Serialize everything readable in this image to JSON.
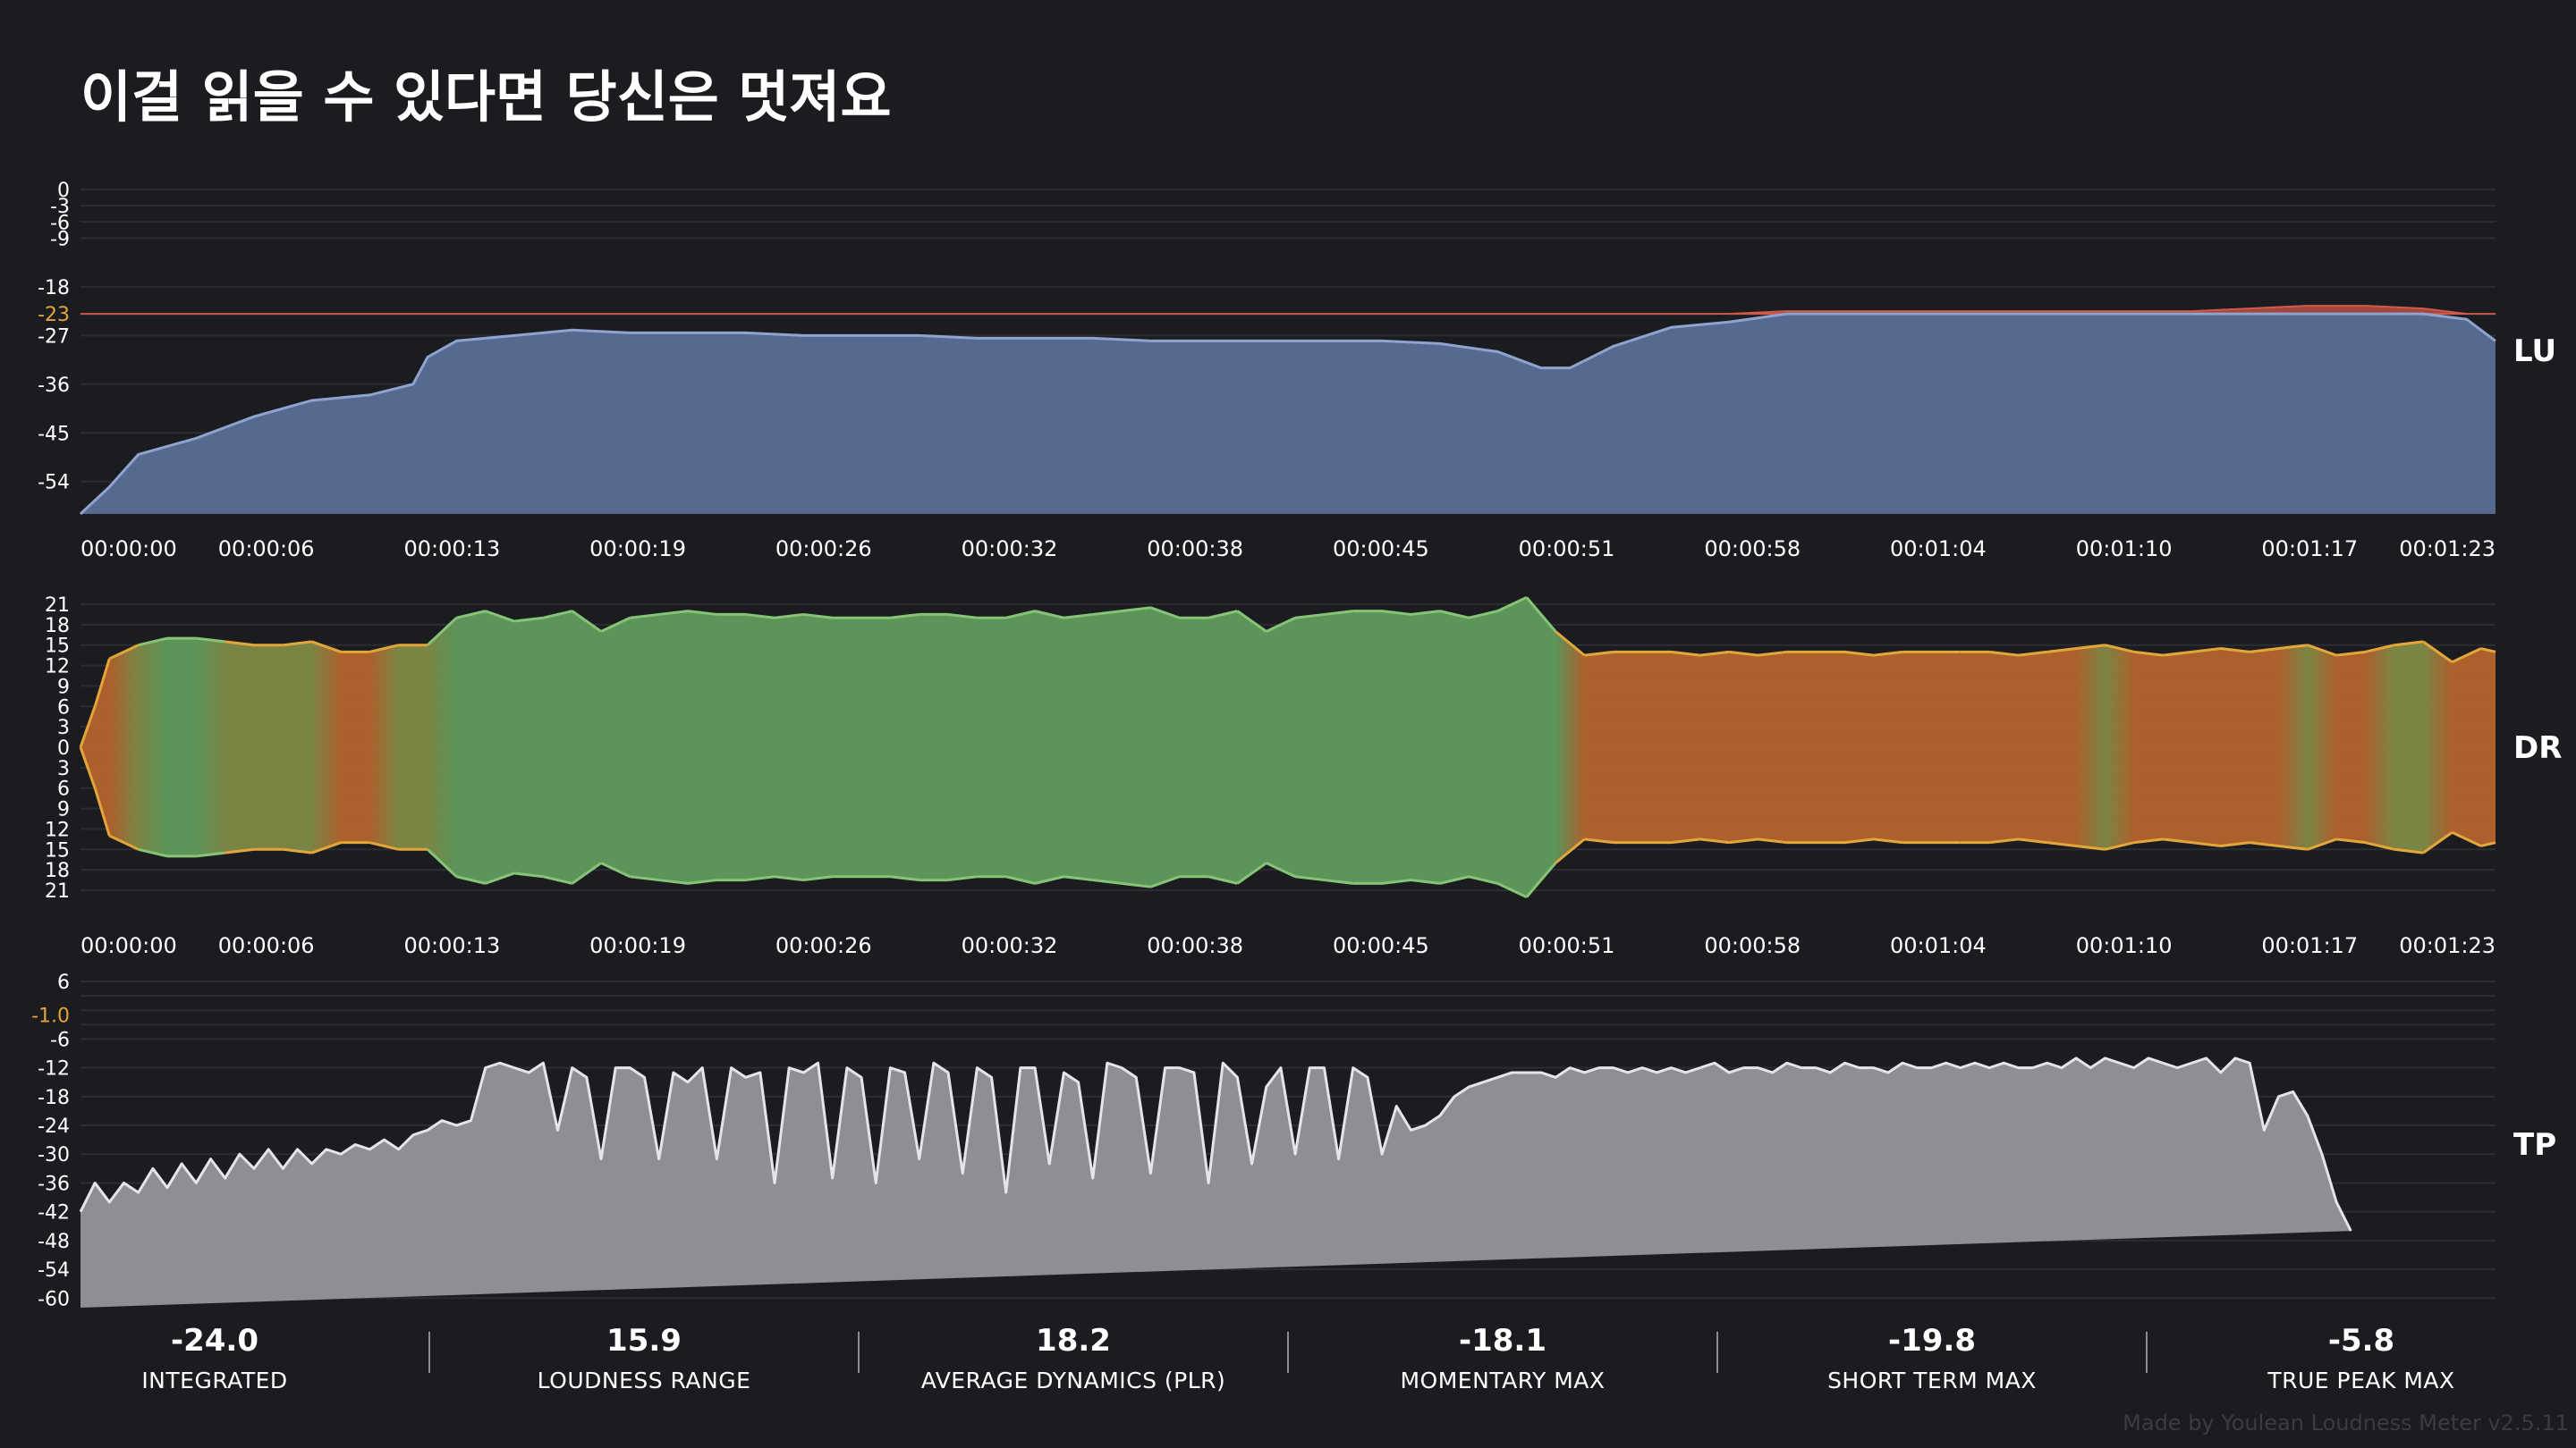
{
  "title": "이걸 읽을 수 있다면 당신은 멋져요",
  "credit": "Made by Youlean Loudness Meter v2.5.11",
  "colors": {
    "background": "#1b1c20",
    "lu_fill": "#56698f",
    "lu_line": "#8fa3cf",
    "lu_over_fill": "#a1473d",
    "lu_over_line": "#d0594a",
    "dr_high": "#5f9a5c",
    "dr_low": "#b4642d",
    "dr_line_high": "#86c476",
    "dr_line_low": "#e3a63a",
    "tp_fill": "#8e8f95",
    "tp_line": "#e4e5e8",
    "target": "#e3a43a"
  },
  "chart_data": [
    {
      "type": "area",
      "name": "LU",
      "side_label": "LU",
      "x_ticks": [
        "00:00:00",
        "00:00:06",
        "00:00:13",
        "00:00:19",
        "00:00:26",
        "00:00:32",
        "00:00:38",
        "00:00:45",
        "00:00:51",
        "00:00:58",
        "00:01:04",
        "00:01:10",
        "00:01:17",
        "00:01:23"
      ],
      "y_ticks": [
        "0",
        "-3",
        "-6",
        "-9",
        "-18",
        "-23",
        "-27",
        "-36",
        "-45",
        "-54"
      ],
      "highlight_tick": "-23",
      "ylim": [
        -60,
        0
      ],
      "target": -23,
      "x_seconds": [
        0,
        1,
        2,
        4,
        6,
        8,
        10,
        11.5,
        12,
        13,
        15,
        17,
        19,
        21,
        23,
        25,
        27,
        29,
        31,
        33,
        35,
        37,
        39,
        41,
        43,
        45,
        47,
        49,
        50.5,
        51.5,
        53,
        55,
        57,
        59,
        61,
        63,
        65,
        67,
        69,
        71,
        73,
        75,
        77,
        79,
        81,
        82.5,
        83.5
      ],
      "values": [
        -60,
        -55,
        -49,
        -46,
        -42,
        -39,
        -38,
        -36,
        -31,
        -28,
        -27,
        -26,
        -26.5,
        -26.5,
        -26.5,
        -27,
        -27,
        -27,
        -27.5,
        -27.5,
        -27.5,
        -28,
        -28,
        -28,
        -28,
        -28,
        -28.5,
        -30,
        -33,
        -33,
        -29,
        -25.5,
        -24.5,
        -22.5,
        -22.5,
        -22.5,
        -22.5,
        -22.5,
        -22.5,
        -22.5,
        -22.5,
        -22,
        -21.5,
        -21.5,
        -22,
        -24,
        -28
      ],
      "grid": true
    },
    {
      "type": "area",
      "name": "DR",
      "side_label": "DR",
      "x_ticks": [
        "00:00:00",
        "00:00:06",
        "00:00:13",
        "00:00:19",
        "00:00:26",
        "00:00:32",
        "00:00:38",
        "00:00:45",
        "00:00:51",
        "00:00:58",
        "00:01:04",
        "00:01:10",
        "00:01:17",
        "00:01:23"
      ],
      "y_ticks": [
        "21",
        "18",
        "15",
        "12",
        "9",
        "6",
        "3",
        "0",
        "3",
        "6",
        "9",
        "12",
        "15",
        "18",
        "21"
      ],
      "ylim": [
        -21,
        21
      ],
      "x_seconds": [
        0,
        0.5,
        1,
        2,
        3,
        4,
        5,
        6,
        7,
        8,
        9,
        10,
        11,
        12,
        13,
        14,
        15,
        16,
        17,
        18,
        19,
        20,
        21,
        22,
        23,
        24,
        25,
        26,
        27,
        28,
        29,
        30,
        31,
        32,
        33,
        34,
        35,
        36,
        37,
        38,
        39,
        40,
        41,
        42,
        43,
        44,
        45,
        46,
        47,
        48,
        49,
        50,
        51,
        52,
        53,
        54,
        55,
        56,
        57,
        58,
        59,
        60,
        61,
        62,
        63,
        64,
        65,
        66,
        67,
        68,
        69,
        70,
        71,
        72,
        73,
        74,
        75,
        76,
        77,
        78,
        79,
        80,
        81,
        82,
        83,
        83.5
      ],
      "values": [
        0,
        6,
        13,
        15,
        16,
        16,
        15.5,
        15,
        15,
        15.5,
        14,
        14,
        15,
        15,
        19,
        20,
        18.5,
        19,
        20,
        17,
        19,
        19.5,
        20,
        19.5,
        19.5,
        19,
        19.5,
        19,
        19,
        19,
        19.5,
        19.5,
        19,
        19,
        20,
        19,
        19.5,
        20,
        20.5,
        19,
        19,
        20,
        17,
        19,
        19.5,
        20,
        20,
        19.5,
        20,
        19,
        20,
        22,
        17,
        13.5,
        14,
        14,
        14,
        13.5,
        14,
        13.5,
        14,
        14,
        14,
        13.5,
        14,
        14,
        14,
        14,
        13.5,
        14,
        14.5,
        15,
        14,
        13.5,
        14,
        14.5,
        14,
        14.5,
        15,
        13.5,
        14,
        15,
        15.5,
        12.5,
        14.5,
        14
      ],
      "grid": true
    },
    {
      "type": "area",
      "name": "TP",
      "side_label": "TP",
      "y_ticks": [
        "6",
        "-1.0",
        "-6",
        "-12",
        "-18",
        "-24",
        "-30",
        "-36",
        "-42",
        "-48",
        "-54",
        "-60"
      ],
      "highlight_tick": "-1.0",
      "ylim": [
        -62,
        6
      ],
      "target": -1,
      "x_seconds": [
        0,
        0.5,
        1,
        1.5,
        2,
        2.5,
        3,
        3.5,
        4,
        4.5,
        5,
        5.5,
        6,
        6.5,
        7,
        7.5,
        8,
        8.5,
        9,
        9.5,
        10,
        10.5,
        11,
        11.5,
        12,
        12.5,
        13,
        13.5,
        14,
        14.5,
        15,
        15.5,
        16,
        16.5,
        17,
        17.5,
        18,
        18.5,
        19,
        19.5,
        20,
        20.5,
        21,
        21.5,
        22,
        22.5,
        23,
        23.5,
        24,
        24.5,
        25,
        25.5,
        26,
        26.5,
        27,
        27.5,
        28,
        28.5,
        29,
        29.5,
        30,
        30.5,
        31,
        31.5,
        32,
        32.5,
        33,
        33.5,
        34,
        34.5,
        35,
        35.5,
        36,
        36.5,
        37,
        37.5,
        38,
        38.5,
        39,
        39.5,
        40,
        40.5,
        41,
        41.5,
        42,
        42.5,
        43,
        43.5,
        44,
        44.5,
        45,
        45.5,
        46,
        46.5,
        47,
        47.5,
        48,
        48.5,
        49,
        49.5,
        50,
        50.5,
        51,
        51.5,
        52,
        52.5,
        53,
        53.5,
        54,
        54.5,
        55,
        55.5,
        56,
        56.5,
        57,
        57.5,
        58,
        58.5,
        59,
        59.5,
        60,
        60.5,
        61,
        61.5,
        62,
        62.5,
        63,
        63.5,
        64,
        64.5,
        65,
        65.5,
        66,
        66.5,
        67,
        67.5,
        68,
        68.5,
        69,
        69.5,
        70,
        70.5,
        71,
        71.5,
        72,
        72.5,
        73,
        73.5,
        74,
        74.5,
        75,
        75.5,
        76,
        76.5,
        77,
        77.5,
        78,
        78.5,
        79,
        79.5,
        80,
        80.5,
        81,
        81.5,
        82,
        82.5,
        83,
        83.5
      ],
      "values": [
        -42,
        -36,
        -40,
        -36,
        -38,
        -33,
        -37,
        -32,
        -36,
        -31,
        -35,
        -30,
        -33,
        -29,
        -33,
        -29,
        -32,
        -29,
        -30,
        -28,
        -29,
        -27,
        -29,
        -26,
        -25,
        -23,
        -24,
        -23,
        -12,
        -11,
        -12,
        -13,
        -11,
        -25,
        -12,
        -14,
        -31,
        -12,
        -12,
        -14,
        -31,
        -13,
        -15,
        -12,
        -31,
        -12,
        -14,
        -13,
        -36,
        -12,
        -13,
        -11,
        -35,
        -12,
        -14,
        -36,
        -12,
        -13,
        -31,
        -11,
        -13,
        -34,
        -12,
        -14,
        -38,
        -12,
        -12,
        -32,
        -13,
        -15,
        -35,
        -11,
        -12,
        -14,
        -34,
        -12,
        -12,
        -13,
        -36,
        -11,
        -14,
        -32,
        -16,
        -12,
        -30,
        -12,
        -12,
        -31,
        -12,
        -14,
        -30,
        -20,
        -25,
        -24,
        -22,
        -18,
        -16,
        -15,
        -14,
        -13,
        -13,
        -13,
        -14,
        -12,
        -13,
        -12,
        -12,
        -13,
        -12,
        -13,
        -12,
        -13,
        -12,
        -11,
        -13,
        -12,
        -12,
        -13,
        -11,
        -12,
        -12,
        -13,
        -11,
        -12,
        -12,
        -13,
        -11,
        -12,
        -12,
        -11,
        -12,
        -11,
        -12,
        -11,
        -12,
        -12,
        -11,
        -12,
        -10,
        -12,
        -10,
        -11,
        -12,
        -10,
        -11,
        -12,
        -11,
        -10,
        -13,
        -10,
        -11,
        -25,
        -18,
        -17,
        -22,
        -30,
        -40,
        -46
      ],
      "grid": true
    }
  ],
  "stats": [
    {
      "value": "-24.0",
      "label": "INTEGRATED"
    },
    {
      "value": "15.9",
      "label": "LOUDNESS RANGE"
    },
    {
      "value": "18.2",
      "label": "AVERAGE DYNAMICS (PLR)"
    },
    {
      "value": "-18.1",
      "label": "MOMENTARY MAX"
    },
    {
      "value": "-19.8",
      "label": "SHORT TERM MAX"
    },
    {
      "value": "-5.8",
      "label": "TRUE PEAK MAX"
    }
  ]
}
